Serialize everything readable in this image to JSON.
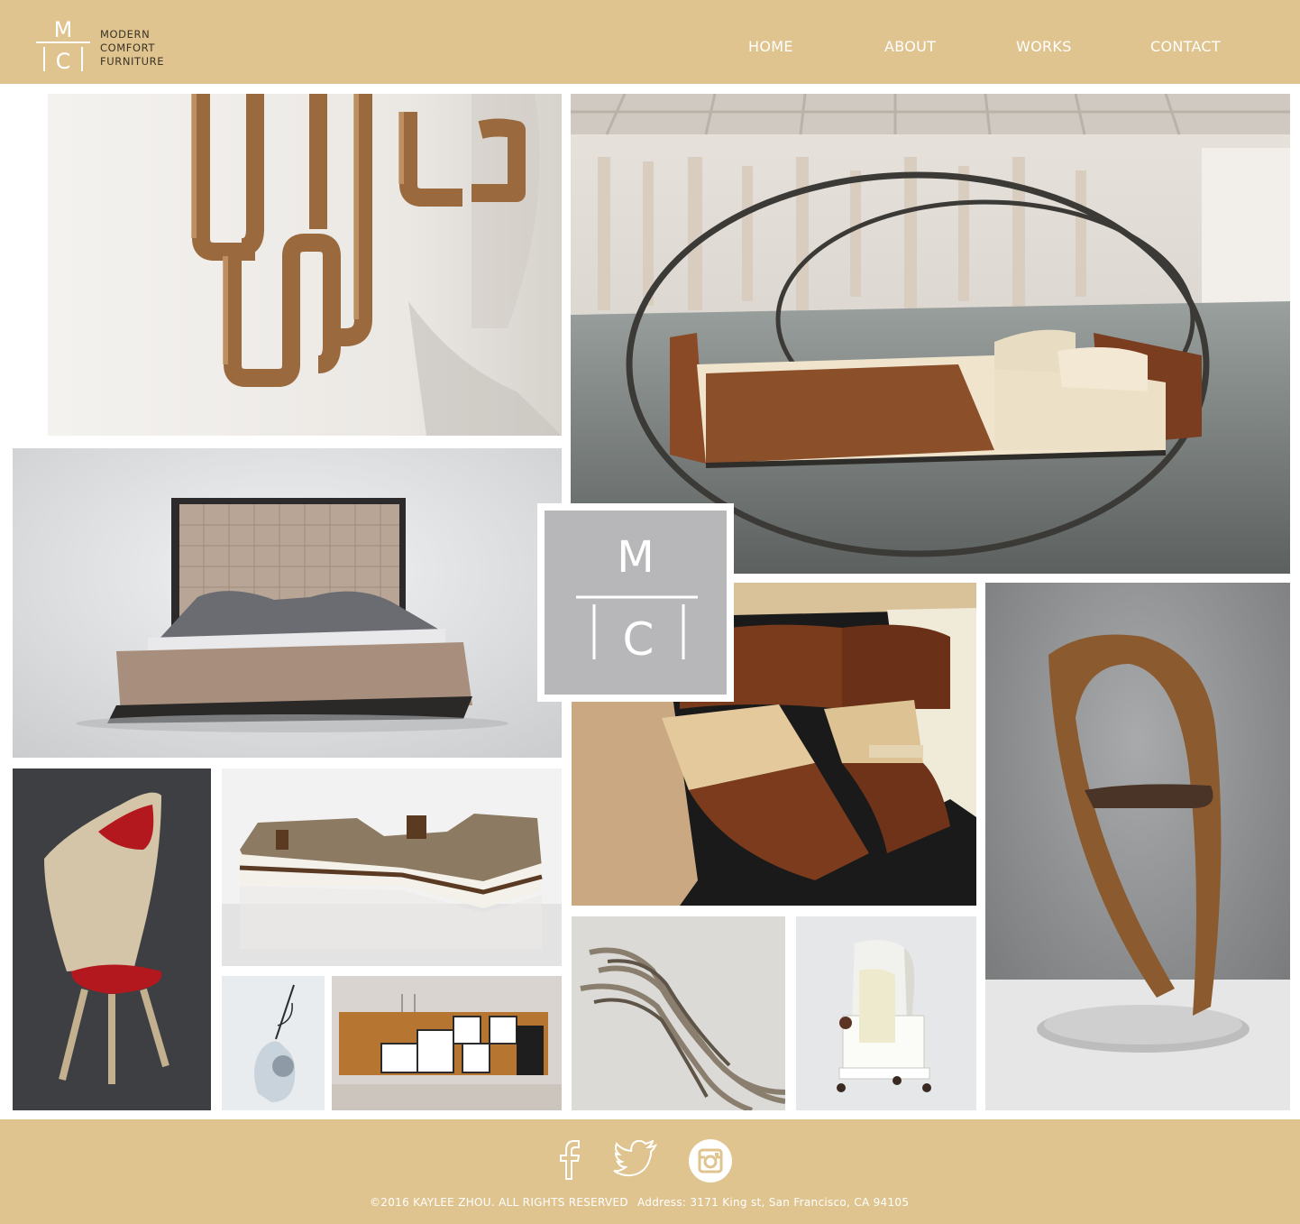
{
  "brand": {
    "logo_letters": {
      "top": "M",
      "bottom": "C"
    },
    "name_lines": [
      "MODERN",
      "COMFORT",
      "FURNITURE"
    ]
  },
  "nav": [
    {
      "label": "HOME"
    },
    {
      "label": "ABOUT"
    },
    {
      "label": "WORKS"
    },
    {
      "label": "CONTACT"
    }
  ],
  "gallery": {
    "center_logo": {
      "top": "M",
      "bottom": "C"
    },
    "items": [
      {
        "icon": "wooden-chain-sculpture"
      },
      {
        "icon": "rocking-bed"
      },
      {
        "icon": "tufted-platform-bed"
      },
      {
        "icon": "curved-wood-drawer-chest"
      },
      {
        "icon": "ribbon-lounge-chair"
      },
      {
        "icon": "red-accent-chair"
      },
      {
        "icon": "sectional-sofa"
      },
      {
        "icon": "sculptural-object"
      },
      {
        "icon": "modular-sideboard"
      },
      {
        "icon": "wave-wood-chair"
      },
      {
        "icon": "hooded-armchair"
      }
    ]
  },
  "footer": {
    "social": [
      {
        "icon": "facebook-icon"
      },
      {
        "icon": "twitter-icon"
      },
      {
        "icon": "instagram-icon"
      }
    ],
    "copyright": "©2016 KAYLEE ZHOU.  ALL RIGHTS RESERVED",
    "address": "Address: 3171 King st, San Francisco, CA 94105"
  },
  "colors": {
    "bar": "#dfc48f",
    "nav_text": "#ffffff",
    "logo_badge": "#b7b7b9"
  }
}
